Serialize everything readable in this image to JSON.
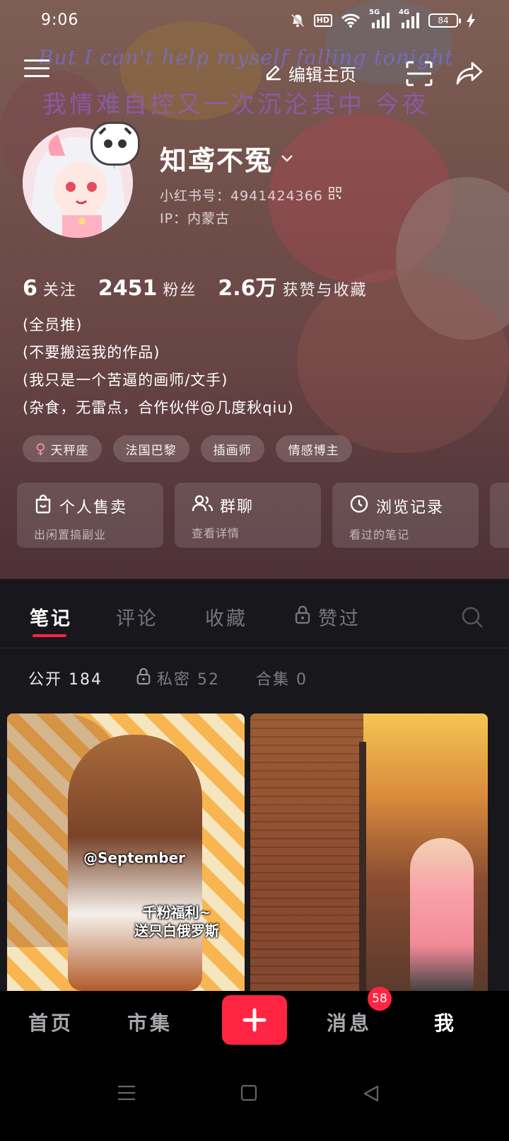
{
  "status_bar": {
    "time": "9:06",
    "network_5g": "5G",
    "network_4g": "4G",
    "hd_label": "HD",
    "battery": "84"
  },
  "header": {
    "edit_label": "编辑主页",
    "overlay_english": "But I can't help myself falling tonight",
    "overlay_chinese": "我情难自控又一次沉沦其中 今夜"
  },
  "profile": {
    "name": "知鸢不冤",
    "redbook_id": "小红书号：4941424366",
    "ip": "IP：内蒙古",
    "stats": [
      {
        "value": "6",
        "label": "关注"
      },
      {
        "value": "2451",
        "label": "粉丝"
      },
      {
        "value": "2.6万",
        "label": "获赞与收藏"
      }
    ],
    "bio": [
      "(全员推)",
      "(不要搬运我的作品)",
      "(我只是一个苦逼的画师/文手)",
      "(杂食，无雷点，合作伙伴@几度秋qiu)"
    ],
    "tags": [
      "天秤座",
      "法国巴黎",
      "插画师",
      "情感博主"
    ]
  },
  "quick_actions": [
    {
      "title": "个人售卖",
      "subtitle": "出闲置搞副业"
    },
    {
      "title": "群聊",
      "subtitle": "查看详情"
    },
    {
      "title": "浏览记录",
      "subtitle": "看过的笔记"
    }
  ],
  "tabs": [
    "笔记",
    "评论",
    "收藏",
    "赞过"
  ],
  "subtabs": {
    "public": "公开 184",
    "private": "私密 52",
    "collections": "合集 0"
  },
  "feed": {
    "card1_label1": "@September",
    "card1_label2_line1": "千粉福利~",
    "card1_label2_line2": "送只白俄罗斯"
  },
  "bottom_nav": {
    "home": "首页",
    "market": "市集",
    "messages": "消息",
    "messages_badge": "58",
    "me": "我"
  },
  "colors": {
    "accent": "#ff2442",
    "content_bg": "#17171c"
  }
}
